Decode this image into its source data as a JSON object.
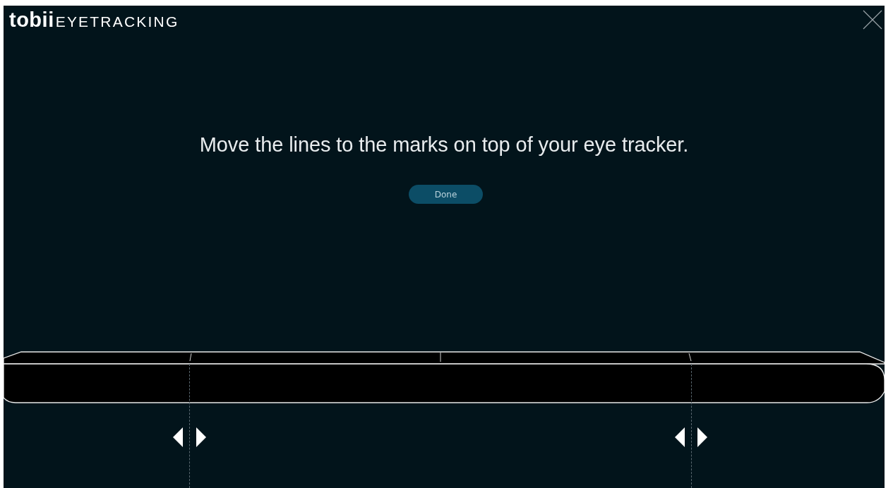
{
  "logo": {
    "brand": "tobii",
    "product": "EYETRACKING"
  },
  "instruction": "Move the lines to the marks on top of your eye tracker.",
  "done_button": {
    "label": "Done"
  }
}
